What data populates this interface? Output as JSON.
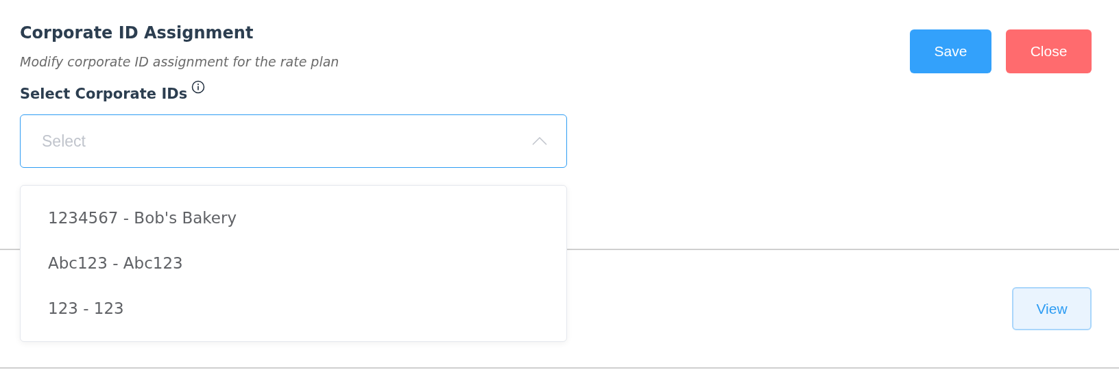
{
  "header": {
    "title": "Corporate ID Assignment",
    "subtitle": "Modify corporate ID assignment for the rate plan"
  },
  "actions": [
    {
      "label": "Save",
      "kind": "primary"
    },
    {
      "label": "Close",
      "kind": "danger"
    }
  ],
  "field": {
    "label": "Select Corporate IDs",
    "placeholder": "Select",
    "expanded": true,
    "options": [
      {
        "label": "1234567 - Bob's Bakery"
      },
      {
        "label": "Abc123 - Abc123"
      },
      {
        "label": "123 - 123"
      }
    ]
  },
  "row": {
    "button": "View"
  }
}
